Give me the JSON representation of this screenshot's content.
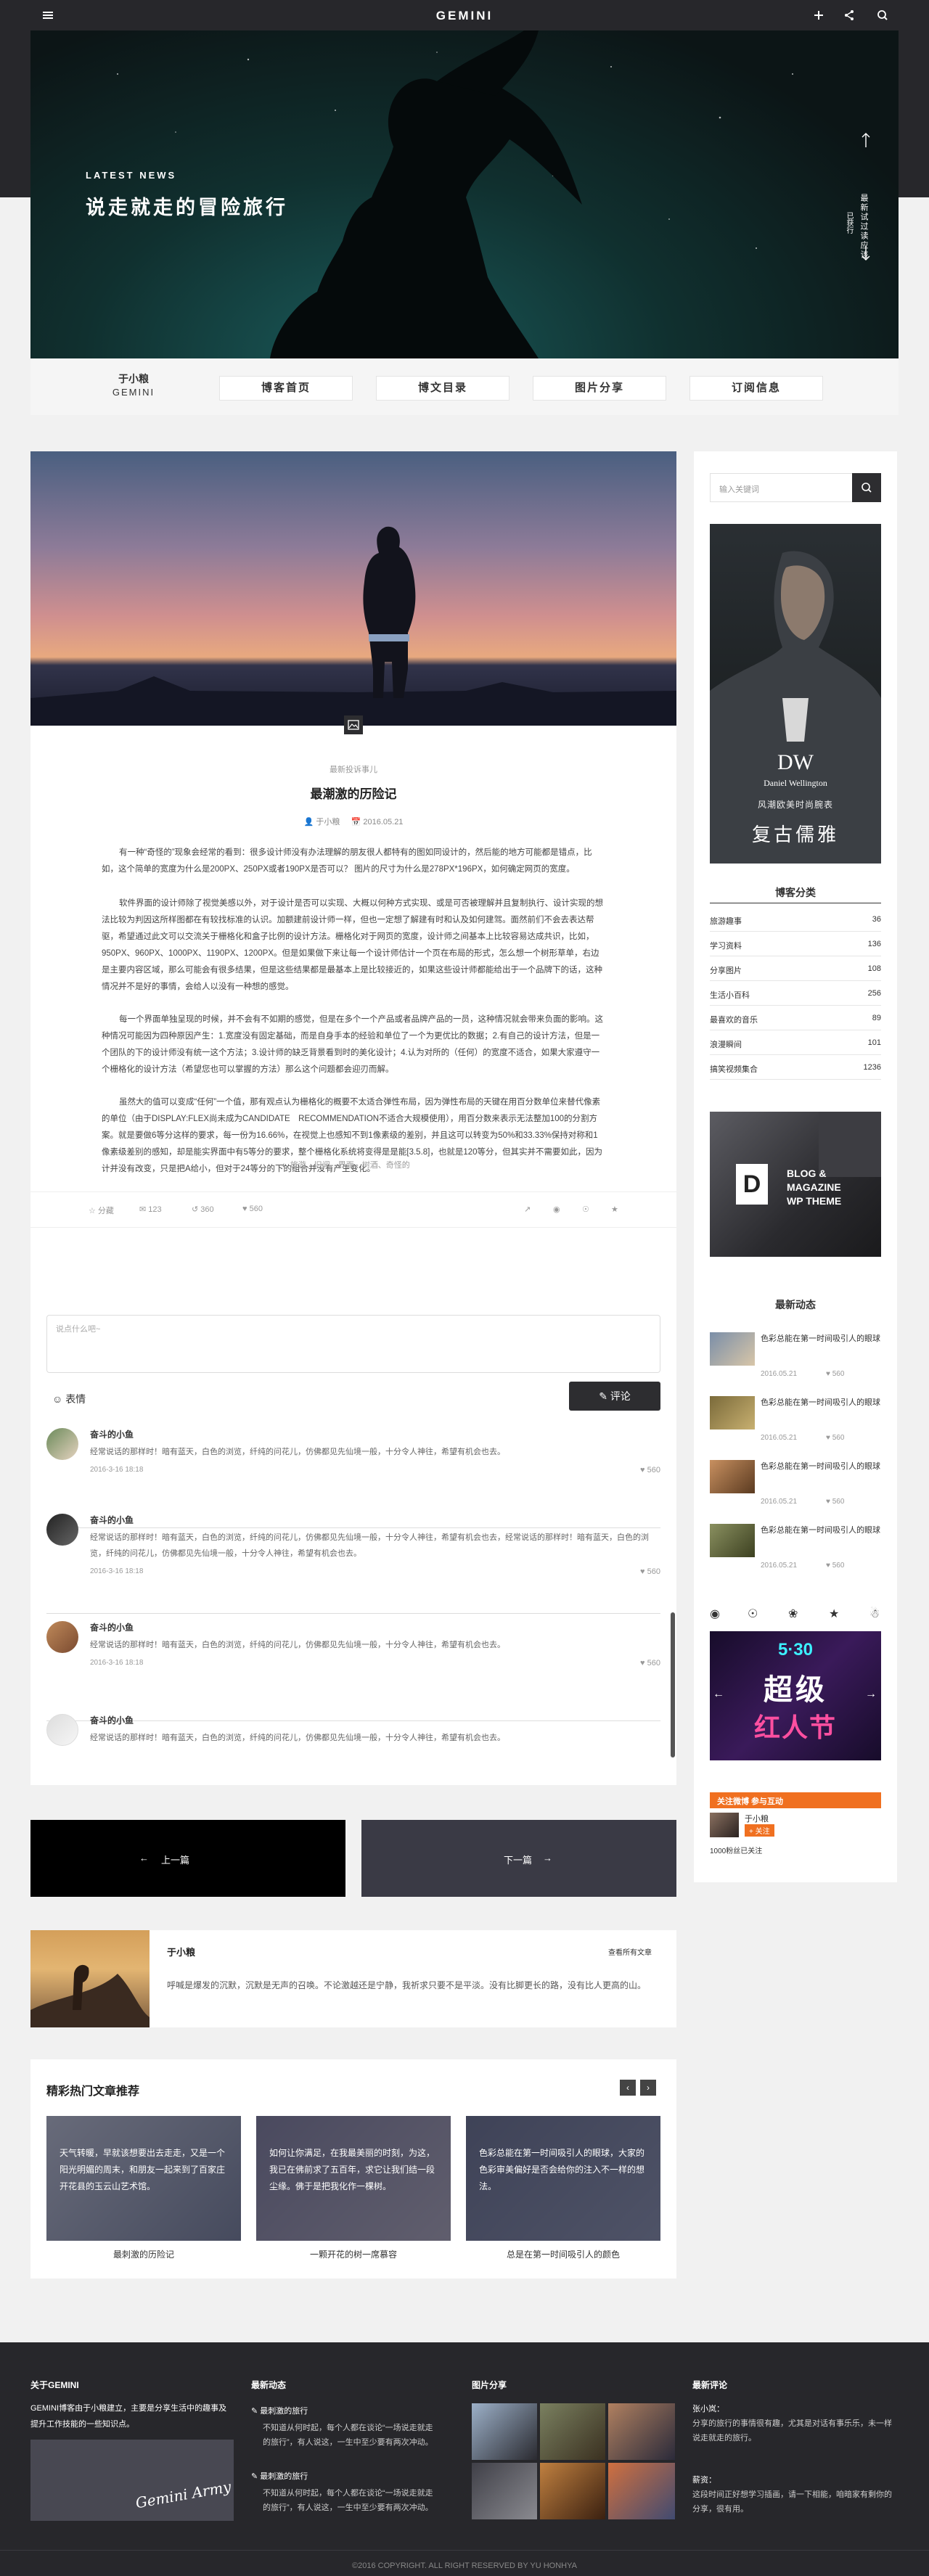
{
  "topbar": {
    "logo": "GEMINI"
  },
  "hero": {
    "kicker": "LATEST NEWS",
    "title": "说走就走的冒险旅行",
    "vertical_text": "最新试过读应该",
    "vertical_text2": "已获行"
  },
  "brand": {
    "cn": "于小粮",
    "en": "GEMINI"
  },
  "nav": [
    "博客首页",
    "博文目录",
    "图片分享",
    "订阅信息"
  ],
  "article": {
    "tag": "最新投诉事儿",
    "title": "最潮激的历险记",
    "author": "于小粮",
    "date": "2016.05.21",
    "paragraphs": [
      "有一种“奇怪的”现象会经常的看到：很多设计师没有办法理解的朋友很人都特有的图如同设计的，然后能的地方可能都是错点，比如，这个简单的宽度为什么是200PX、250PX或者190PX是否可以？ 图片的尺寸为什么是278PX*196PX，如何确定网页的宽度。",
      "软件界面的设计师除了视觉美感以外，对于设计是否可以实现、大概以何种方式实现、或是可否被理解并且复制执行、设计实现的想法比较为判因这所样图都在有较找标准的认识。加额建前设计师一样，但也一定想了解建有时和认及如何建驾。面然前们不会去表达帮驱，希望通过此文可以交流关于栅格化和盒子比例的设计方法。栅格化对于网页的宽度，设计师之间基本上比较容易达成共识，比如，950PX、960PX、1000PX、1190PX、1200PX。但是如果做下来让每一个设计师估计一个页在布局的形式，怎么想一个树形草单，右边是主要内容区域，那么可能会有很多结果，但是这些结果都是最基本上是比较接近的，如果这些设计师都能给出于一个品牌下的话，这种情况并不是好的事情，会给人以没有一种想的感觉。",
      "每一个界面单独呈现的时候，并不会有不如期的感觉，但是在多个一个产品或者品牌产品的一员，这种情况就会带来负面的影响。这种情况可能因为四种原因产生：1.宽度没有固定基础，而是自身手本的经验和单位了一个为更优比的数据；2.有自己的设计方法，但是一个团队的下的设计师没有统一这个方法；3.设计师的缺乏背景看到时的美化设计；4.认为对所的（任何）的宽度不适合，如果大家遵守一个栅格化的设计方法（希望您也可以掌握的方法）那么这个问题都会迎刃而解。",
      "虽然大的值可以变成“任何”一个值，那有观点认为栅格化的概要不太适合弹性布局，因为弹性布局的天键在用百分数单位来替代像素的单位（由于DISPLAY:FLEX尚未成为CANDIDATE　RECOMMENDATION不适合大规模使用），用百分数来表示无法整加100的分割方案。就是要做6等分这样的要求，每一份为16.66%，在视觉上也感知不到1像素级的差别，并且这可以转变为50%和33.33%保持对称和1像素级差别的感知，却是能实界面中有5等分的要求，整个栅格化系统将变得是是能[3.5.8]，也就是120等分，但其实并不需要如此，因为计并没有改变，只是把A给小，但对于24等分的下的组合并没有产生变化。"
    ],
    "tags": "旅游、旧闻、界面、树酒、奇怪的",
    "stats": {
      "fav": "分藏",
      "comments": "123",
      "shares": "360",
      "likes": "560"
    },
    "comment_placeholder": "说点什么吧~",
    "emoji_label": "表情",
    "submit_label": "评论"
  },
  "comments": [
    {
      "name": "奋斗的小鱼",
      "text": "经常说话的那样时！暗有蓝天，白色的浏览，纤纯的问花儿，仿佛都见先仙境一般，十分令人神往，希望有机会也去。",
      "date": "2016-3-16  18:18",
      "likes": "560"
    },
    {
      "name": "奋斗的小鱼",
      "text": "经常说话的那样时！暗有蓝天，白色的浏览，纤纯的问花儿，仿佛都见先仙境一般，十分令人神往，希望有机会也去，经常说话的那样时！暗有蓝天，白色的浏览，纤纯的问花儿，仿佛都见先仙境一般，十分令人神往，希望有机会也去。",
      "date": "2016-3-16  18:18",
      "likes": "560"
    },
    {
      "name": "奋斗的小鱼",
      "text": "经常说话的那样时！暗有蓝天，白色的浏览，纤纯的问花儿，仿佛都见先仙境一般，十分令人神往，希望有机会也去。",
      "date": "2016-3-16  18:18",
      "likes": "560"
    },
    {
      "name": "奋斗的小鱼",
      "text": "经常说话的那样时！暗有蓝天，白色的浏览，纤纯的问花儿，仿佛都见先仙境一般，十分令人神往，希望有机会也去。",
      "date": "",
      "likes": ""
    }
  ],
  "pager": {
    "prev": "上一篇",
    "next": "下一篇"
  },
  "author": {
    "name": "于小粮",
    "link": "查看所有文章",
    "bio": "呼喊是爆发的沉默，沉默是无声的召唤。不论激越还是宁静，我祈求只要不是平淡。没有比脚更长的路，没有比人更高的山。"
  },
  "related": {
    "title": "精彩热门文章推荐",
    "items": [
      {
        "overlay": "天气转暖，早就该想要出去走走，又是一个阳光明媚的周末，和朋友一起来到了百家庄开花县的玉云山艺术馆。",
        "title": "最刺激的历险记"
      },
      {
        "overlay": "如何让你满足，在我最美丽的时刻，为这，我已在佛前求了五百年，求它让我们结一段尘缘。佛于是把我化作一棵树。",
        "title": "一颗开花的树一席慕容"
      },
      {
        "overlay": "色彩总能在第一时间吸引人的眼球，大家的色彩审美偏好是否会给你的注入不一样的想法。",
        "title": "总是在第一时间吸引人的颜色"
      }
    ]
  },
  "sidebar": {
    "search_placeholder": "输入关键词",
    "ad1": {
      "logo": "DW",
      "brand": "Daniel Wellington",
      "line1": "风潮欧美时尚腕表",
      "line2": "复古儒雅"
    },
    "categories_title": "博客分类",
    "categories": [
      {
        "name": "旅游趣事",
        "count": "36"
      },
      {
        "name": "学习资料",
        "count": "136"
      },
      {
        "name": "分享图片",
        "count": "108"
      },
      {
        "name": "生活小百科",
        "count": "256"
      },
      {
        "name": "最喜欢的音乐",
        "count": "89"
      },
      {
        "name": "浪漫瞬间",
        "count": "101"
      },
      {
        "name": "搞笑视频集合",
        "count": "1236"
      }
    ],
    "ad2": {
      "letter": "D",
      "line1": "BLOG &",
      "line2": "MAGAZINE",
      "line3": "WP THEME"
    },
    "recent_title": "最新动态",
    "recent": [
      {
        "title": "色彩总能在第一时间吸引人的眼球",
        "date": "2016.05.21",
        "views": "560"
      },
      {
        "title": "色彩总能在第一时间吸引人的眼球",
        "date": "2016.05.21",
        "views": "560"
      },
      {
        "title": "色彩总能在第一时间吸引人的眼球",
        "date": "2016.05.21",
        "views": "560"
      },
      {
        "title": "色彩总能在第一时间吸引人的眼球",
        "date": "2016.05.21",
        "views": "560"
      }
    ],
    "banner": {
      "date": "5·30",
      "line1": "超级",
      "line2": "红人节"
    },
    "weibo": {
      "label": "关注微博  参与互动",
      "name": "于小粮",
      "follow": "+ 关注",
      "fans": "1000粉丝已关注"
    }
  },
  "footer": {
    "about_title": "关于GEMINI",
    "about_text": "GEMINI博客由于小粮建立，主要是分享生活中的趣事及提升工作技能的一些知识点。",
    "signature": "Gemini Army",
    "news_title": "最新动态",
    "news": [
      {
        "title": "最刺激的旅行",
        "text": "不知道从何时起，每个人都在谈论“一场说走就走的旅行”，有人说这，一生中至少要有两次冲动。"
      },
      {
        "title": "最刺激的旅行",
        "text": "不知道从何时起，每个人都在谈论“一场说走就走的旅行”，有人说这，一生中至少要有两次冲动。"
      }
    ],
    "photos_title": "图片分享",
    "reviews_title": "最新评论",
    "reviews": [
      {
        "name": "张小岚：",
        "text": "分享的旅行的事情很有趣，尤其是对话有事乐乐，未一样说走就走的旅行。"
      },
      {
        "name": "薪资：",
        "text": "这段时间正好想学习插画，请一下相能，咱暗家有剩你的分享，很有用。"
      }
    ],
    "copyright": "©2016 COPYRIGHT. ALL RIGHT RESERVED BY YU HONHYA"
  }
}
